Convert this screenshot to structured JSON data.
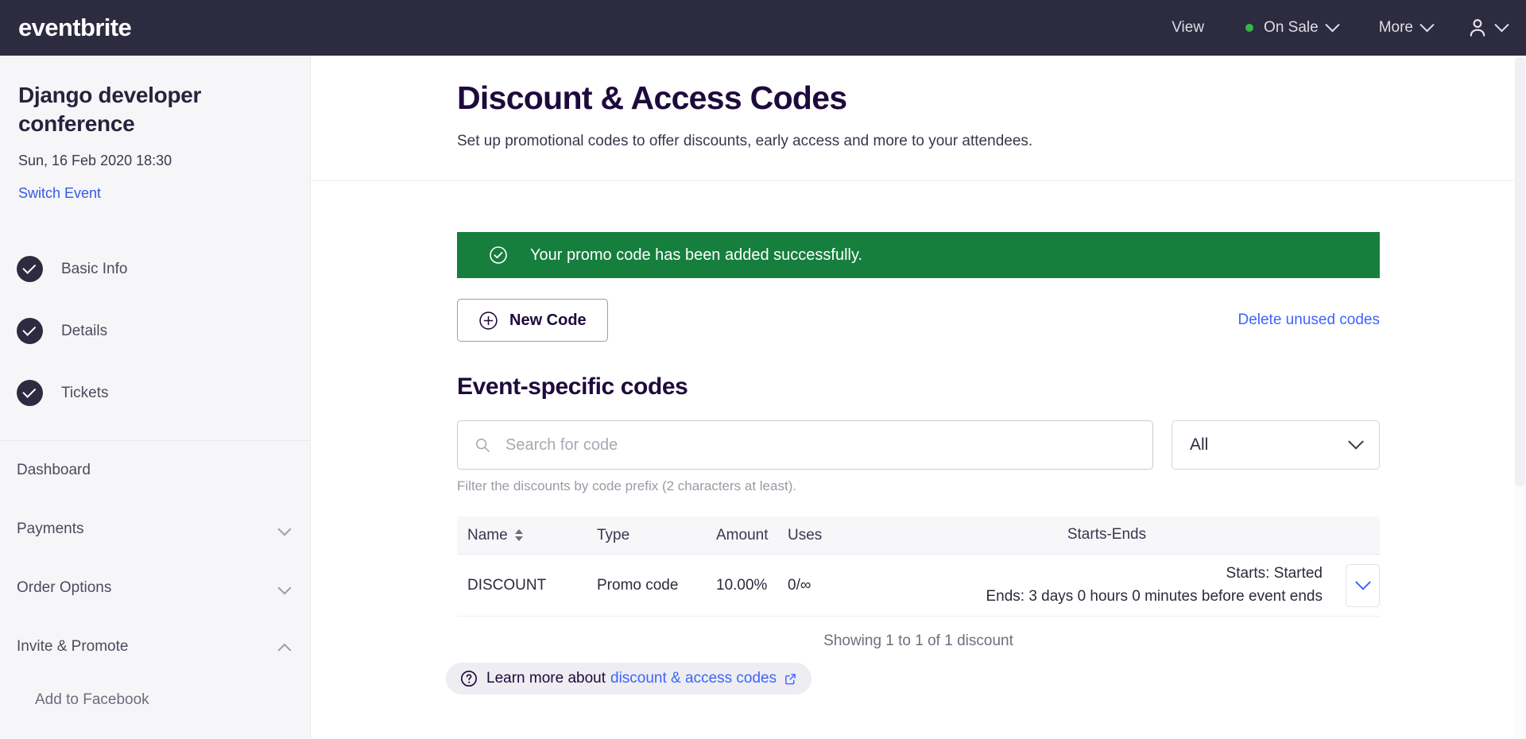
{
  "topbar": {
    "brand": "eventbrite",
    "items": [
      {
        "label": "View",
        "icon": "none",
        "chevron": false
      },
      {
        "label": "On Sale",
        "icon": "status-dot",
        "chevron": true
      },
      {
        "label": "More",
        "icon": "none",
        "chevron": true
      }
    ],
    "account_icon": "person-icon",
    "account_chevron": "chevron-down-icon",
    "bg_color": "#2d2b3f",
    "status_dot_color": "#39b54a"
  },
  "sidebar": {
    "event_title": "Django developer conference",
    "event_date": "Sun, 16 Feb 2020 18:30",
    "switch_event": "Switch Event",
    "steps": [
      {
        "label": "Basic Info",
        "complete": true
      },
      {
        "label": "Details",
        "complete": true
      },
      {
        "label": "Tickets",
        "complete": true
      }
    ],
    "nav": [
      {
        "label": "Dashboard",
        "chevron": "none"
      },
      {
        "label": "Payments",
        "chevron": "down"
      },
      {
        "label": "Order Options",
        "chevron": "down"
      },
      {
        "label": "Invite & Promote",
        "chevron": "up"
      }
    ],
    "sub_items": [
      {
        "label": "Add to Facebook"
      }
    ]
  },
  "main": {
    "title": "Discount & Access Codes",
    "subtitle": "Set up promotional codes to offer discounts, early access and more to your attendees.",
    "alert": {
      "message": "Your promo code has been added successfully.",
      "icon": "check-circle-icon",
      "bg_color": "#167f3d"
    },
    "new_code_button": "New Code",
    "delete_unused_link": "Delete unused codes",
    "section_title": "Event-specific codes",
    "search": {
      "placeholder": "Search for code",
      "value": "",
      "helper": "Filter the discounts by code prefix (2 characters at least)."
    },
    "filter_select": {
      "value": "All",
      "options": [
        "All"
      ]
    },
    "table": {
      "columns": [
        "Name",
        "Type",
        "Amount",
        "Uses",
        "Starts-Ends"
      ],
      "sort_column": "Name",
      "rows": [
        {
          "name": "DISCOUNT",
          "type": "Promo code",
          "amount": "10.00%",
          "uses": "0/∞",
          "starts": "Starts: Started",
          "ends": "Ends: 3 days 0 hours 0 minutes before event ends"
        }
      ],
      "showing": "Showing 1 to 1 of 1 discount"
    },
    "learn_more": {
      "prefix": "Learn more about",
      "link": "discount & access codes",
      "icon": "question-circle-icon",
      "external_icon": "external-link-icon"
    }
  },
  "theme": {
    "accent_blue": "#3d64ff",
    "title_purple": "#1e0a3c",
    "sidebar_bg": "#f6f6f9"
  }
}
